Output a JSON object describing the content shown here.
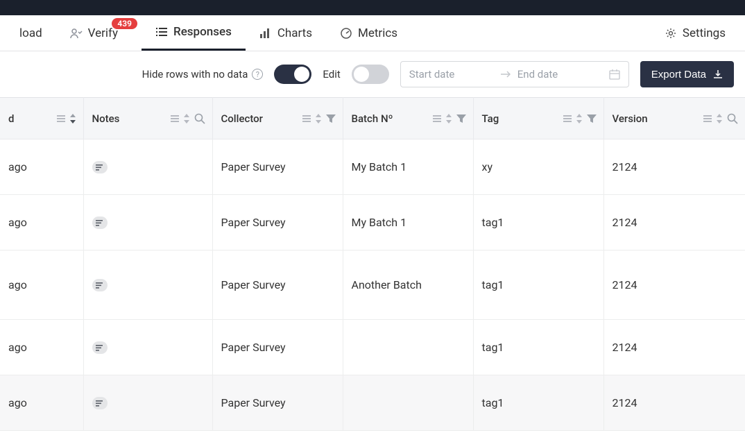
{
  "nav": {
    "tabs": [
      {
        "label": "load",
        "icon": "upload"
      },
      {
        "label": "Verify",
        "icon": "user-check",
        "badge": "439"
      },
      {
        "label": "Responses",
        "icon": "list",
        "active": true
      },
      {
        "label": "Charts",
        "icon": "bar-chart"
      },
      {
        "label": "Metrics",
        "icon": "gauge"
      }
    ],
    "settings_label": "Settings"
  },
  "controls": {
    "hide_label": "Hide rows with no data",
    "edit_label": "Edit",
    "start_placeholder": "Start date",
    "end_placeholder": "End date",
    "export_label": "Export Data"
  },
  "columns": {
    "c0": "d",
    "c1": "Notes",
    "c2": "Collector",
    "c3": "Batch Nº",
    "c4": "Tag",
    "c5": "Version"
  },
  "rows": [
    {
      "time": "ago",
      "collector": "Paper Survey",
      "batch": "My Batch 1",
      "tag": "xy",
      "version": "2124"
    },
    {
      "time": "ago",
      "collector": "Paper Survey",
      "batch": "My Batch 1",
      "tag": "tag1",
      "version": "2124"
    },
    {
      "time": "ago",
      "collector": "Paper Survey",
      "batch": "Another Batch",
      "tag": "tag1",
      "version": "2124"
    },
    {
      "time": "ago",
      "collector": "Paper Survey",
      "batch": "",
      "tag": "tag1",
      "version": "2124"
    },
    {
      "time": "ago",
      "collector": "Paper Survey",
      "batch": "",
      "tag": "tag1",
      "version": "2124"
    }
  ]
}
